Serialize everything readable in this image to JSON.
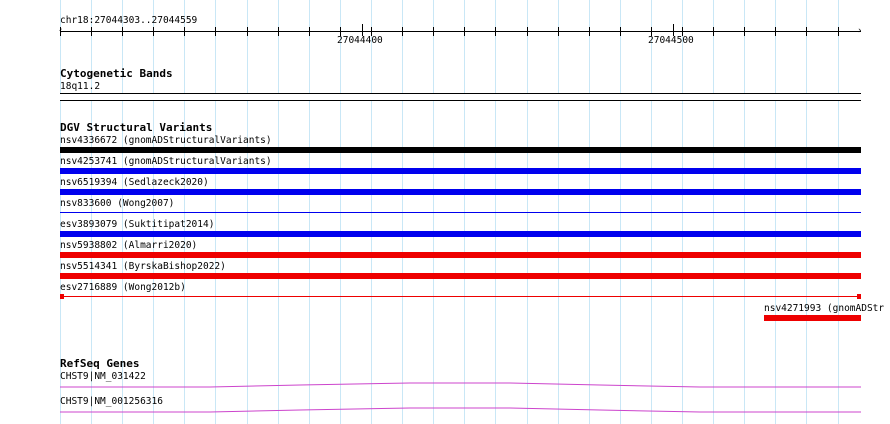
{
  "ruler": {
    "locus": "chr18:27044303..27044559",
    "labels": [
      {
        "text": "27044400",
        "pos": 27044400
      },
      {
        "text": "27044500",
        "pos": 27044500
      }
    ]
  },
  "cytoband": {
    "title": "Cytogenetic Bands",
    "band": "18q11.2"
  },
  "dgv": {
    "title": "DGV Structural Variants",
    "items": [
      {
        "label": "nsv4336672 (gnomADStructuralVariants)",
        "color": "#000000",
        "style": "thick"
      },
      {
        "label": "nsv4253741 (gnomADStructuralVariants)",
        "color": "#0000ee",
        "style": "thick"
      },
      {
        "label": "nsv6519394 (Sedlazeck2020)",
        "color": "#0000ee",
        "style": "thick"
      },
      {
        "label": "nsv833600 (Wong2007)",
        "color": "#0000ee",
        "style": "thin"
      },
      {
        "label": "esv3893079 (Suktitipat2014)",
        "color": "#0000ee",
        "style": "thick"
      },
      {
        "label": "nsv5938802 (Almarri2020)",
        "color": "#ee0000",
        "style": "thick"
      },
      {
        "label": "nsv5514341 (ByrskaBishop2022)",
        "color": "#ee0000",
        "style": "thick"
      },
      {
        "label": "esv2716889 (Wong2012b)",
        "color": "#ee0000",
        "style": "thin-capped"
      }
    ],
    "extra": {
      "label": "nsv4271993 (gnomADStr",
      "color": "#ee0000"
    }
  },
  "refseq": {
    "title": "RefSeq Genes",
    "items": [
      {
        "label": "CHST9|NM_031422",
        "color": "#cc44cc"
      },
      {
        "label": "CHST9|NM_001256316",
        "color": "#cc44cc"
      }
    ]
  }
}
